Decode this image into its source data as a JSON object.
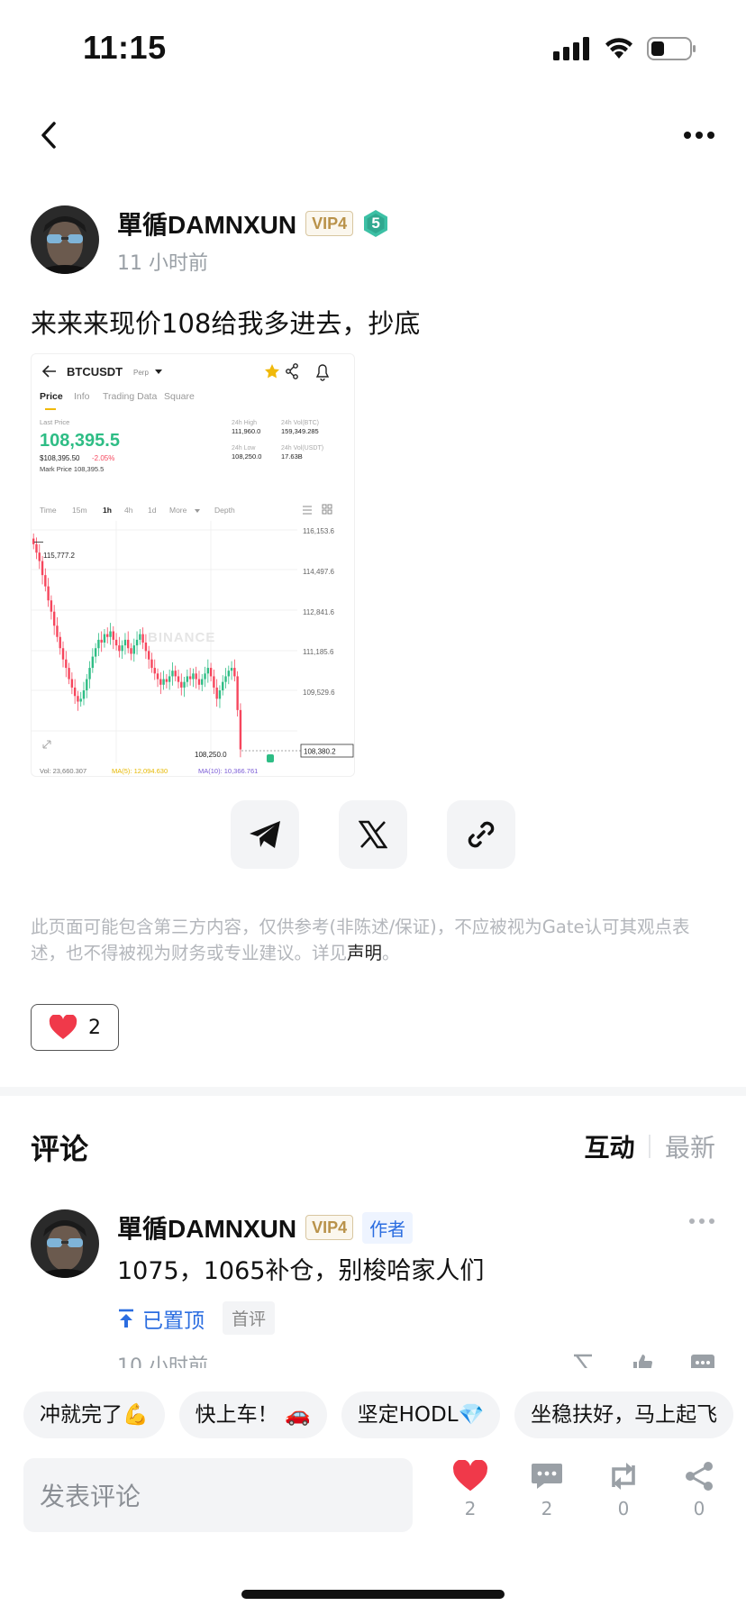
{
  "status_bar": {
    "time": "11:15"
  },
  "post": {
    "author": "單循DAMNXUN",
    "vip": "VIP4",
    "level": "5",
    "time": "11 小时前",
    "text": "来来来现价108给我多进去，抄底"
  },
  "chart_image": {
    "symbol": "BTCUSDT",
    "perp": "Perp",
    "tabs": [
      "Price",
      "Info",
      "Trading Data",
      "Square"
    ],
    "last_price_label": "Last Price",
    "last_price": "108,395.5",
    "usd_price": "$108,395.50",
    "change": "-2.05%",
    "mark_price": "Mark Price  108,395.5",
    "high_label": "24h High",
    "high": "111,960.0",
    "vol_btc_label": "24h Vol(BTC)",
    "vol_btc": "159,349.285",
    "low_label": "24h Low",
    "low": "108,250.0",
    "vol_usdt_label": "24h Vol(USDT)",
    "vol_usdt": "17.63B",
    "intervals": [
      "Time",
      "15m",
      "1h",
      "4h",
      "1d",
      "More",
      "Depth"
    ],
    "y_ticks": [
      "116,153.6",
      "114,497.6",
      "112,841.6",
      "111,185.6",
      "109,529.6"
    ],
    "hi_mark": "115,777.2",
    "lo_mark": "108,250.0",
    "current_tag": "108,380.2",
    "watermark": "BINANCE",
    "vol_label": "Vol: 23,660.307",
    "ma5": "MA(5): 12,094.630",
    "ma10": "MA(10): 10,366.761",
    "up_color": "#2ebd85",
    "down_color": "#f6465d"
  },
  "disclaimer": {
    "text": "此页面可能包含第三方内容，仅供参考(非陈述/保证)，不应被视为Gate认可其观点表述，也不得被视为财务或专业建议。详见",
    "link": "声明",
    "end": "。"
  },
  "likes": {
    "count": "2"
  },
  "comments": {
    "title": "评论",
    "sort_active": "互动",
    "sort_inactive": "最新",
    "items": [
      {
        "author": "單循DAMNXUN",
        "vip": "VIP4",
        "tag": "作者",
        "text": "1075，1065补仓，别梭哈家人们",
        "pinned": "已置顶",
        "first": "首评",
        "time": "10 小时前"
      }
    ]
  },
  "quick_replies": [
    "冲就完了💪",
    "快上车！ 🚗",
    "坚定HODL💎",
    "坐稳扶好，马上起飞"
  ],
  "bottom_bar": {
    "input_placeholder": "发表评论",
    "likes": "2",
    "comments": "2",
    "reposts": "0",
    "shares": "0"
  },
  "colors": {
    "accent_blue": "#2b6de0",
    "like_red": "#f0394a",
    "vip_gold": "#b9924a",
    "level_green": "#3cc0a5"
  }
}
